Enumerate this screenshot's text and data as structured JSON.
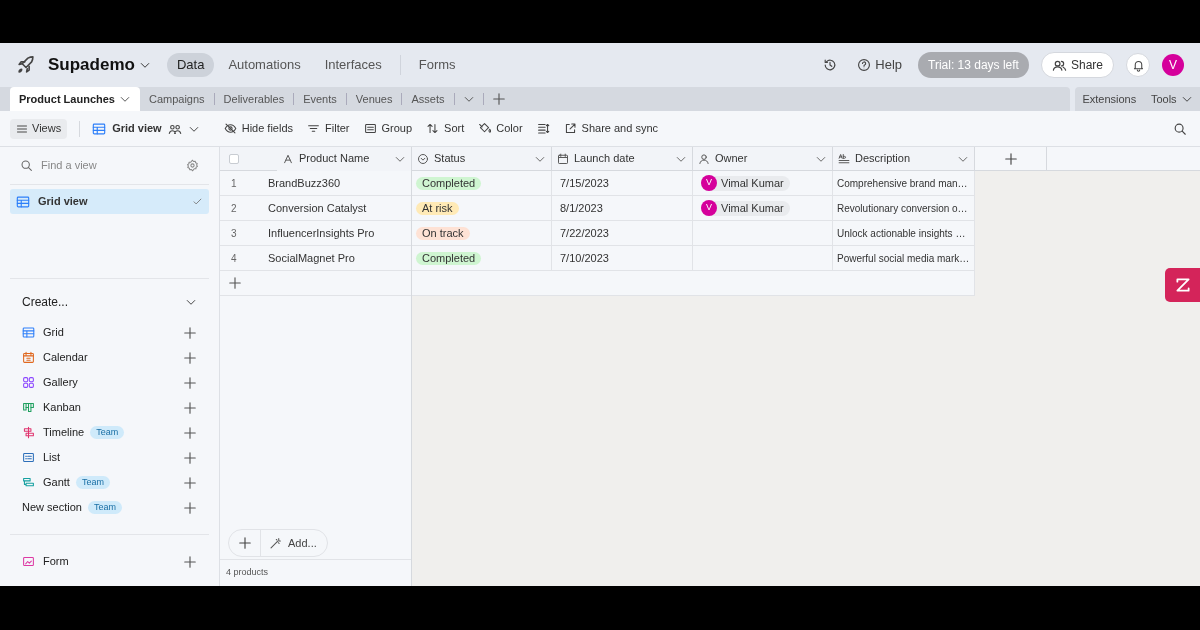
{
  "header": {
    "base_name": "Supademo",
    "nav": [
      {
        "label": "Data",
        "selected": true
      },
      {
        "label": "Automations",
        "selected": false
      },
      {
        "label": "Interfaces",
        "selected": false
      },
      {
        "label": "Forms",
        "selected": false
      }
    ],
    "help": "Help",
    "trial": "Trial: 13 days left",
    "share": "Share",
    "avatar": "V"
  },
  "table_tabs": [
    {
      "label": "Product Launches",
      "selected": true
    },
    {
      "label": "Campaigns",
      "selected": false
    },
    {
      "label": "Deliverables",
      "selected": false
    },
    {
      "label": "Events",
      "selected": false
    },
    {
      "label": "Venues",
      "selected": false
    },
    {
      "label": "Assets",
      "selected": false
    }
  ],
  "right_tabs": [
    "Extensions",
    "Tools"
  ],
  "toolbar": {
    "views": "Views",
    "view_name": "Grid view",
    "actions": [
      "Hide fields",
      "Filter",
      "Group",
      "Sort",
      "Color",
      "Share and sync"
    ]
  },
  "sidebar": {
    "search_placeholder": "Find a view",
    "views": [
      {
        "label": "Grid view",
        "selected": true
      }
    ],
    "create_title": "Create...",
    "create_items": [
      {
        "kind": "grid",
        "label": "Grid"
      },
      {
        "kind": "calendar",
        "label": "Calendar"
      },
      {
        "kind": "gallery",
        "label": "Gallery"
      },
      {
        "kind": "kanban",
        "label": "Kanban"
      },
      {
        "kind": "timeline",
        "label": "Timeline",
        "badge": "Team"
      },
      {
        "kind": "list",
        "label": "List"
      },
      {
        "kind": "gantt",
        "label": "Gantt",
        "badge": "Team"
      },
      {
        "kind": "section",
        "label": "New section",
        "badge": "Team"
      },
      {
        "kind": "form",
        "label": "Form"
      }
    ]
  },
  "table": {
    "select_all_checked": false,
    "columns": [
      "Product Name",
      "Status",
      "Launch date",
      "Owner",
      "Description"
    ],
    "rows": [
      {
        "number": "1",
        "name": "BrandBuzz360",
        "status": {
          "label": "Completed",
          "color": "#cff5d1"
        },
        "date": "7/15/2023",
        "owner": {
          "avatar": "V",
          "name": "Vimal Kumar"
        },
        "description": "Comprehensive brand man…"
      },
      {
        "number": "2",
        "name": "Conversion Catalyst",
        "status": {
          "label": "At risk",
          "color": "#ffeab6"
        },
        "date": "8/1/2023",
        "owner": {
          "avatar": "V",
          "name": "Vimal Kumar"
        },
        "description": "Revolutionary conversion o…"
      },
      {
        "number": "3",
        "name": "InfluencerInsights Pro",
        "status": {
          "label": "On track",
          "color": "#fee2d5"
        },
        "date": "7/22/2023",
        "description": "Unlock actionable insights …"
      },
      {
        "number": "4",
        "name": "SocialMagnet Pro",
        "status": {
          "label": "Completed",
          "color": "#cff5d1"
        },
        "date": "7/10/2023",
        "description": "Powerful social media mark…"
      }
    ],
    "add_label": "Add...",
    "record_count": "4 products"
  }
}
